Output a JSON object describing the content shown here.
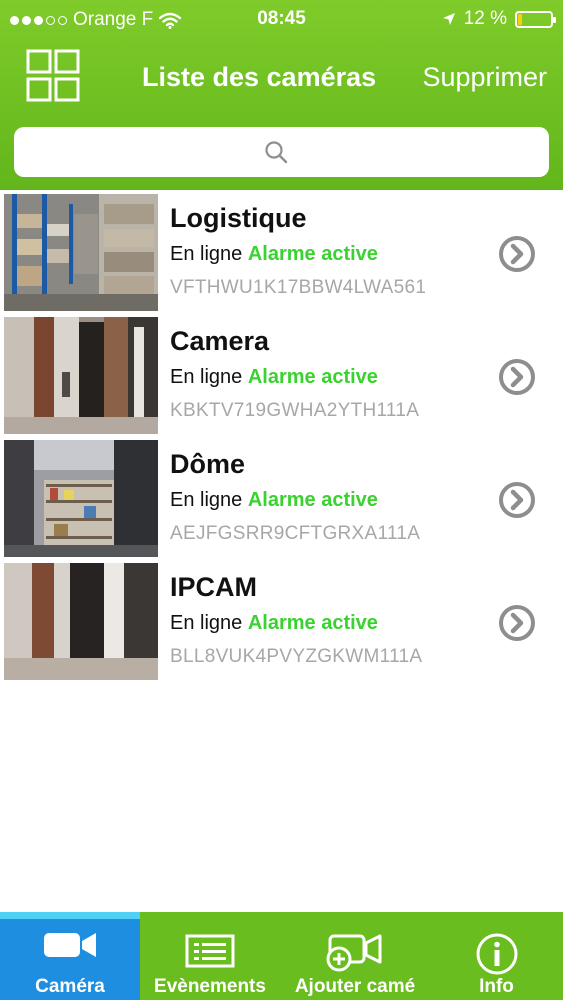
{
  "status_bar": {
    "carrier": "Orange F",
    "time": "08:45",
    "battery": "12 %",
    "battery_level": 0.12
  },
  "nav": {
    "title": "Liste des caméras",
    "delete_label": "Supprimer"
  },
  "search": {
    "placeholder": ""
  },
  "cameras": [
    {
      "name": "Logistique",
      "status": "En ligne",
      "alarm": "Alarme active",
      "id": "VFTHWU1K17BBW4LWA561"
    },
    {
      "name": "Camera",
      "status": "En ligne",
      "alarm": "Alarme active",
      "id": "KBKTV719GWHA2YTH111A"
    },
    {
      "name": "Dôme",
      "status": "En ligne",
      "alarm": "Alarme active",
      "id": "AEJFGSRR9CFTGRXA111A"
    },
    {
      "name": "IPCAM",
      "status": "En ligne",
      "alarm": "Alarme active",
      "id": "BLL8VUK4PVYZGKWM111A"
    }
  ],
  "tabs": [
    {
      "label": "Caméra",
      "icon": "video-camera-icon",
      "active": true
    },
    {
      "label": "Evènements",
      "icon": "list-icon",
      "active": false
    },
    {
      "label": "Ajouter camé",
      "icon": "add-camera-icon",
      "active": false
    },
    {
      "label": "Info",
      "icon": "info-icon",
      "active": false
    }
  ],
  "colors": {
    "header_green": "#62b61b",
    "tabbar_green": "#69bd1e",
    "alarm_green": "#3ad22f",
    "active_tab_blue": "#1e8fe0",
    "id_gray": "#a7a7a7"
  }
}
